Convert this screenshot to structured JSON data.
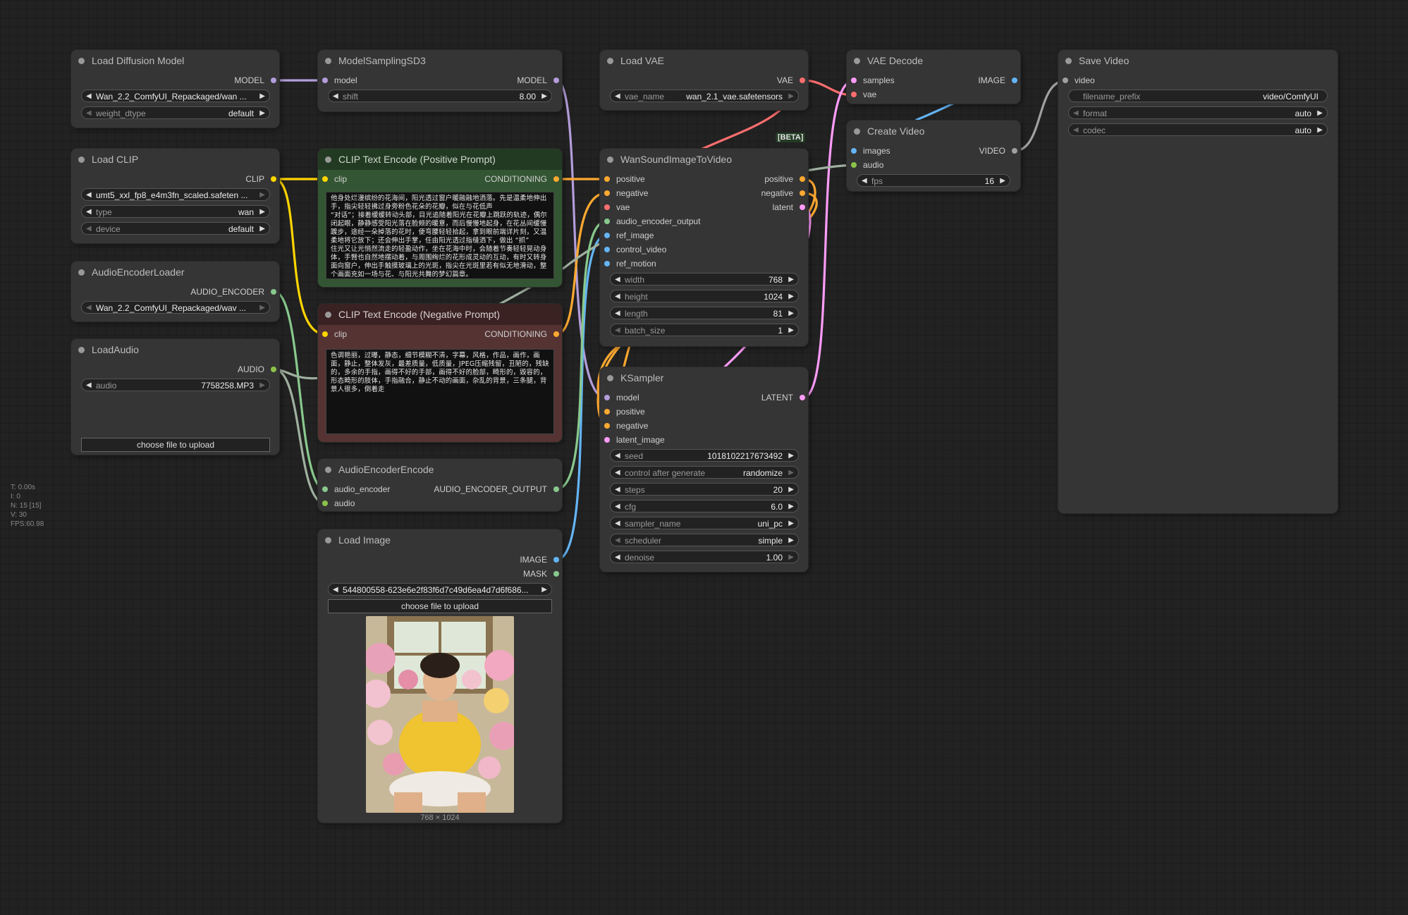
{
  "nodes": {
    "load_diffusion": {
      "title": "Load Diffusion Model",
      "out_model": "MODEL",
      "unet_name": "Wan_2.2_ComfyUI_Repackaged/wan ...",
      "weight_dtype_label": "weight_dtype",
      "weight_dtype": "default"
    },
    "load_clip": {
      "title": "Load CLIP",
      "out_clip": "CLIP",
      "clip_name": "umt5_xxl_fp8_e4m3fn_scaled.safeten ...",
      "type_label": "type",
      "type": "wan",
      "device_label": "device",
      "device": "default"
    },
    "audio_encoder_loader": {
      "title": "AudioEncoderLoader",
      "out": "AUDIO_ENCODER",
      "name": "Wan_2.2_ComfyUI_Repackaged/wav ..."
    },
    "load_audio": {
      "title": "LoadAudio",
      "out": "AUDIO",
      "audio_label": "audio",
      "audio": "7758258.MP3",
      "upload": "choose file to upload"
    },
    "model_sampling": {
      "title": "ModelSamplingSD3",
      "in_model": "model",
      "out_model": "MODEL",
      "shift_label": "shift",
      "shift": "8.00"
    },
    "clip_pos": {
      "title": "CLIP Text Encode (Positive Prompt)",
      "in_clip": "clip",
      "out": "CONDITIONING",
      "text": "他身处烂漫缤纷的花海间，阳光透过窗户暖融融地洒落。先是温柔地伸出手，指尖轻轻拂过身旁粉色花朵的花瓣，似在与花低声\n“对话”；接着缓缓转动头部，目光追随着阳光在花瓣上跳跃的轨迹，偶尔闭起眼，静静感受阳光落在脸颊的暖意，而后慢慢地起身，在花丛间缓慢踱步，途经一朵掉落的花时，便弯腰轻轻拾起，拿到眼前端详片刻，又温柔地将它放下；还会伸出手掌，任由阳光透过指缝洒下，做出 “抓”\n住光又让光悄然流走的轻盈动作，坐在花海中时，会随着节奏轻轻晃动身体，手臂也自然地摆动着，与周围绚烂的花形成灵动的互动，有时又转身面向窗户，伸出手触摸玻璃上的光斑，指尖在光斑里若有似无地滑动，整个画面充如一场与花、与阳光共舞的梦幻篇章。"
    },
    "clip_neg": {
      "title": "CLIP Text Encode (Negative Prompt)",
      "in_clip": "clip",
      "out": "CONDITIONING",
      "text": "色调艳丽，过曝，静态，细节模糊不清，字幕，风格，作品，画作，画面，静止，整体发灰，最差质量，低质量，JPEG压缩残留，丑陋的，残缺的，多余的手指，画得不好的手部，画得不好的脸部，畸形的，毁容的，形态畸形的肢体，手指融合，静止不动的画面，杂乱的背景，三条腿，背景人很多，倒着走"
    },
    "audio_encoder_encode": {
      "title": "AudioEncoderEncode",
      "in_encoder": "audio_encoder",
      "in_audio": "audio",
      "out": "AUDIO_ENCODER_OUTPUT"
    },
    "load_image": {
      "title": "Load Image",
      "out_image": "IMAGE",
      "out_mask": "MASK",
      "image": "544800558-623e6e2f83f6d7c49d6ea4d7d6f686...",
      "upload": "choose file to upload",
      "size": "768 × 1024"
    },
    "load_vae": {
      "title": "Load VAE",
      "out": "VAE",
      "vae_label": "vae_name",
      "vae": "wan_2.1_vae.safetensors"
    },
    "wan": {
      "title": "WanSoundImageToVideo",
      "badge": "[BETA]",
      "in_positive": "positive",
      "in_negative": "negative",
      "in_vae": "vae",
      "in_audio_enc": "audio_encoder_output",
      "in_ref_image": "ref_image",
      "in_control_video": "control_video",
      "in_ref_motion": "ref_motion",
      "out_positive": "positive",
      "out_negative": "negative",
      "out_latent": "latent",
      "width_label": "width",
      "width": "768",
      "height_label": "height",
      "height": "1024",
      "length_label": "length",
      "length": "81",
      "batch_label": "batch_size",
      "batch": "1"
    },
    "ksampler": {
      "title": "KSampler",
      "in_model": "model",
      "in_positive": "positive",
      "in_negative": "negative",
      "in_latent": "latent_image",
      "out": "LATENT",
      "seed_label": "seed",
      "seed": "1018102217673492",
      "cag_label": "control after generate",
      "cag": "randomize",
      "steps_label": "steps",
      "steps": "20",
      "cfg_label": "cfg",
      "cfg": "6.0",
      "sampler_label": "sampler_name",
      "sampler": "uni_pc",
      "scheduler_label": "scheduler",
      "scheduler": "simple",
      "denoise_label": "denoise",
      "denoise": "1.00"
    },
    "vae_decode": {
      "title": "VAE Decode",
      "in_samples": "samples",
      "in_vae": "vae",
      "out": "IMAGE"
    },
    "create_video": {
      "title": "Create Video",
      "in_images": "images",
      "in_audio": "audio",
      "out": "VIDEO",
      "fps_label": "fps",
      "fps": "16"
    },
    "save_video": {
      "title": "Save Video",
      "in_video": "video",
      "prefix_label": "filename_prefix",
      "prefix": "video/ComfyUI",
      "format_label": "format",
      "format": "auto",
      "codec_label": "codec",
      "codec": "auto"
    }
  },
  "stats": {
    "t": "T: 0.00s",
    "i": "I: 0",
    "n": "N: 15 [15]",
    "v": "V: 30",
    "fps": "FPS:60.98"
  },
  "colors": {
    "model": "#b39ddb",
    "clip": "#ffd500",
    "conditioning": "#ffa931",
    "vae": "#ff6e6e",
    "latent": "#ff9cf9",
    "image": "#64b5f6",
    "audio": "#8bc34a",
    "audio_encoder": "#88c98d",
    "video": "#a0a0a0"
  }
}
